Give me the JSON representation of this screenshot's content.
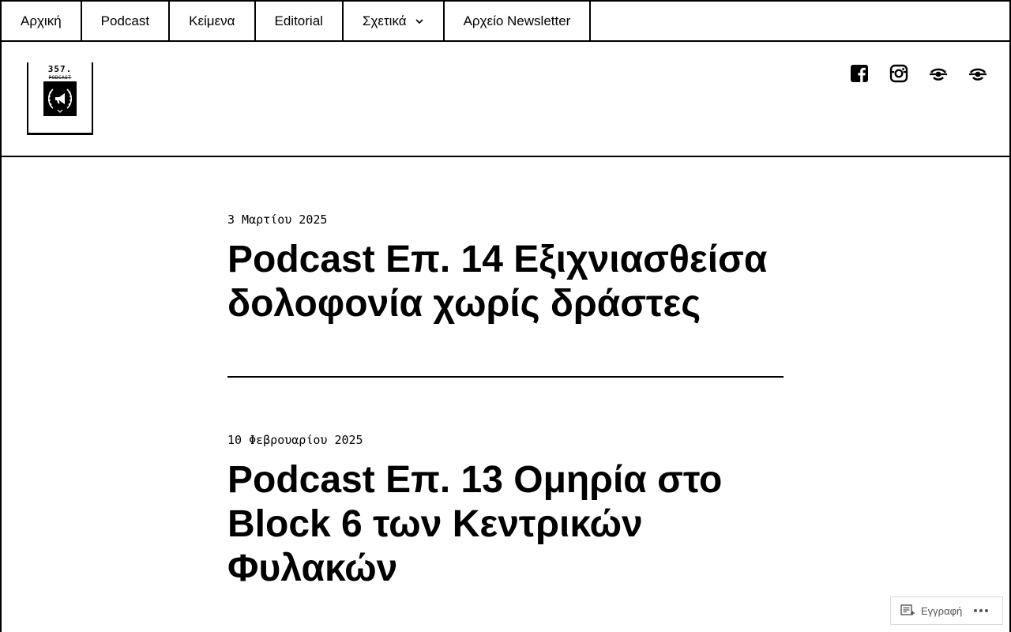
{
  "nav": {
    "items": [
      {
        "label": "Αρχική"
      },
      {
        "label": "Podcast"
      },
      {
        "label": "Κείμενα"
      },
      {
        "label": "Editorial"
      },
      {
        "label": "Σχετικά",
        "has_dropdown": true
      },
      {
        "label": "Αρχείο Newsletter"
      }
    ]
  },
  "header": {
    "logo": {
      "number": "357.",
      "subtitle": "PODCAST"
    },
    "social": [
      "facebook-icon",
      "instagram-icon",
      "generic-link-icon",
      "generic-link-icon"
    ]
  },
  "posts": [
    {
      "date": "3 Μαρτίου 2025",
      "title": "Podcast Επ. 14 Εξιχνιασθείσα δολοφονία χωρίς δράστες"
    },
    {
      "date": "10 Φεβρουαρίου 2025",
      "title": "Podcast Επ. 13 Ομηρία στο Block 6 των Κεντρικών Φυλακών"
    }
  ],
  "subscribe": {
    "label": "Εγγραφή"
  },
  "colors": {
    "text": "#000000",
    "background": "#ffffff",
    "subscribe_text": "#555555"
  }
}
